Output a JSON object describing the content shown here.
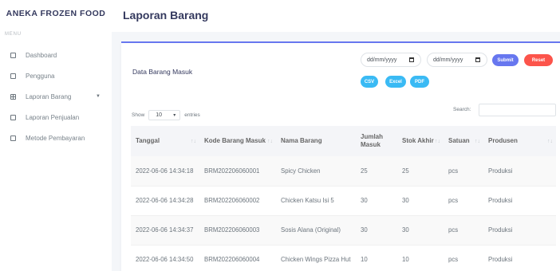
{
  "brand": "ANEKA FROZEN FOOD",
  "menu_header": "MENU",
  "menu": [
    {
      "label": "Dashboard"
    },
    {
      "label": "Pengguna"
    },
    {
      "label": "Laporan Barang"
    },
    {
      "label": "Laporan Penjualan"
    },
    {
      "label": "Metode Pembayaran"
    }
  ],
  "page_title": "Laporan Barang",
  "card": {
    "title": "Data Barang Masuk",
    "date_from": "dd/mm/yyyy",
    "date_to": "dd/mm/yyyy",
    "submit_label": "Submit",
    "reset_label": "Reset",
    "export": {
      "csv": "CSV",
      "excel": "Excel",
      "pdf": "PDF"
    }
  },
  "table_controls": {
    "show_label": "Show",
    "entries_value": "10",
    "entries_label": "entries",
    "search_label": "Search:"
  },
  "table": {
    "headers": [
      "Tanggal",
      "Kode Barang Masuk",
      "Nama Barang",
      "Jumlah Masuk",
      "Stok Akhir",
      "Satuan",
      "Produsen"
    ],
    "rows": [
      [
        "2022-06-06 14:34:18",
        "BRM202206060001",
        "Spicy Chicken",
        "25",
        "25",
        "pcs",
        "Produksi"
      ],
      [
        "2022-06-06 14:34:28",
        "BRM202206060002",
        "Chicken Katsu Isi 5",
        "30",
        "30",
        "pcs",
        "Produksi"
      ],
      [
        "2022-06-06 14:34:37",
        "BRM202206060003",
        "Sosis Alana (Original)",
        "30",
        "30",
        "pcs",
        "Produksi"
      ],
      [
        "2022-06-06 14:34:50",
        "BRM202206060004",
        "Chicken Wings Pizza Hut",
        "10",
        "10",
        "pcs",
        "Produksi"
      ]
    ]
  },
  "colors": {
    "primary": "#6777ef",
    "danger": "#fc544b",
    "info": "#3abaf4"
  }
}
